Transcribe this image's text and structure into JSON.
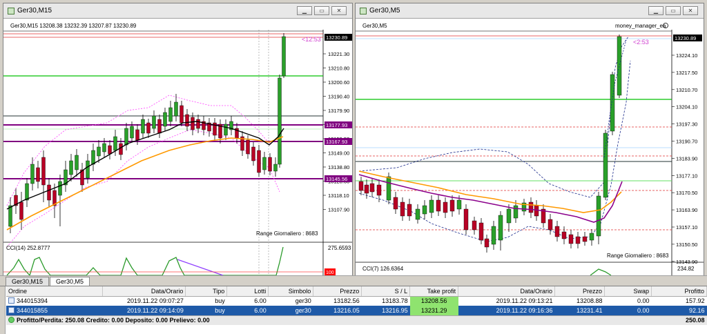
{
  "left": {
    "title": "Ger30,M15",
    "header_label": "Ger30,M15  13208.38 13232.39 13207.87 13230.89",
    "current_price": "13230.89",
    "countdown": "<12:53",
    "range_text": "Range Giornaliero :  8683",
    "indicator_label": "CCI(14) 252.8777",
    "indicator_top": "275.6593",
    "indicator_level": "100",
    "price_ticks": [
      "13221.30",
      "13210.80",
      "13200.60",
      "13190.40",
      "13179.90",
      "13169.70",
      "13159.50",
      "13149.00",
      "13138.80",
      "13128.30",
      "13118.10",
      "13107.90"
    ],
    "hline_labels": [
      {
        "price": "13177.93",
        "color": "#800080"
      },
      {
        "price": "13167.93",
        "color": "#800080"
      },
      {
        "price": "13145.56",
        "color": "#800080"
      }
    ]
  },
  "right": {
    "title": "Ger30,M5",
    "header_label": "Ger30,M5",
    "ea_label": "money_manager_ea",
    "current_price": "13230.89",
    "countdown": "<2:53",
    "range_text": "Range Giornaliero :  8683",
    "indicator_label": "CCI(7) 126.6364",
    "indicator_top": "234.82",
    "price_ticks": [
      "13224.10",
      "13217.50",
      "13210.70",
      "13204.10",
      "13197.30",
      "13190.70",
      "13183.90",
      "13177.10",
      "13170.50",
      "13163.90",
      "13157.10",
      "13150.50",
      "13143.90"
    ]
  },
  "window_buttons": {
    "minimize": "▁",
    "restore": "▭",
    "close": "✕"
  },
  "tabs": [
    {
      "label": "Ger30,M15",
      "active": false
    },
    {
      "label": "Ger30,M5",
      "active": true
    }
  ],
  "orders": {
    "columns": [
      "Ordine",
      "Data/Orario",
      "Tipo",
      "Lotti",
      "Simbolo",
      "Prezzo",
      "S / L",
      "Take profit",
      "Data/Orario",
      "Prezzo",
      "Swap",
      "Profitto"
    ],
    "rows": [
      {
        "ticket": "344015394",
        "open_time": "2019.11.22 09:07:27",
        "type": "buy",
        "lots": "6.00",
        "symbol": "ger30",
        "price": "13182.56",
        "sl": "13183.78",
        "tp": "13208.56",
        "time": "2019.11.22 09:13:21",
        "cur_price": "13208.88",
        "swap": "0.00",
        "profit": "157.92"
      },
      {
        "ticket": "344015855",
        "open_time": "2019.11.22 09:14:09",
        "type": "buy",
        "lots": "6.00",
        "symbol": "ger30",
        "price": "13216.05",
        "sl": "13216.95",
        "tp": "13231.29",
        "time": "2019.11.22 09:16:36",
        "cur_price": "13231.41",
        "swap": "0.00",
        "profit": "92.16"
      }
    ],
    "summary": "Profitto/Perdita: 250.08  Credito: 0.00  Deposito: 0.00  Prelievo: 0.00",
    "summary_total": "250.08"
  },
  "colors": {
    "bull": "#2aa02a",
    "bear": "#b80025",
    "green_line": "#00c000",
    "purple_line": "#800080",
    "dark_line": "#203030",
    "red_dotted": "#e03030",
    "ma_black": "#000000",
    "ma_orange": "#ff9900",
    "ma_purple": "#8b008b",
    "band": "#ff3cff",
    "band_right": "#1a2a8a",
    "cci": "#2a9a2a",
    "indicator_level_line": "#ff4040"
  }
}
